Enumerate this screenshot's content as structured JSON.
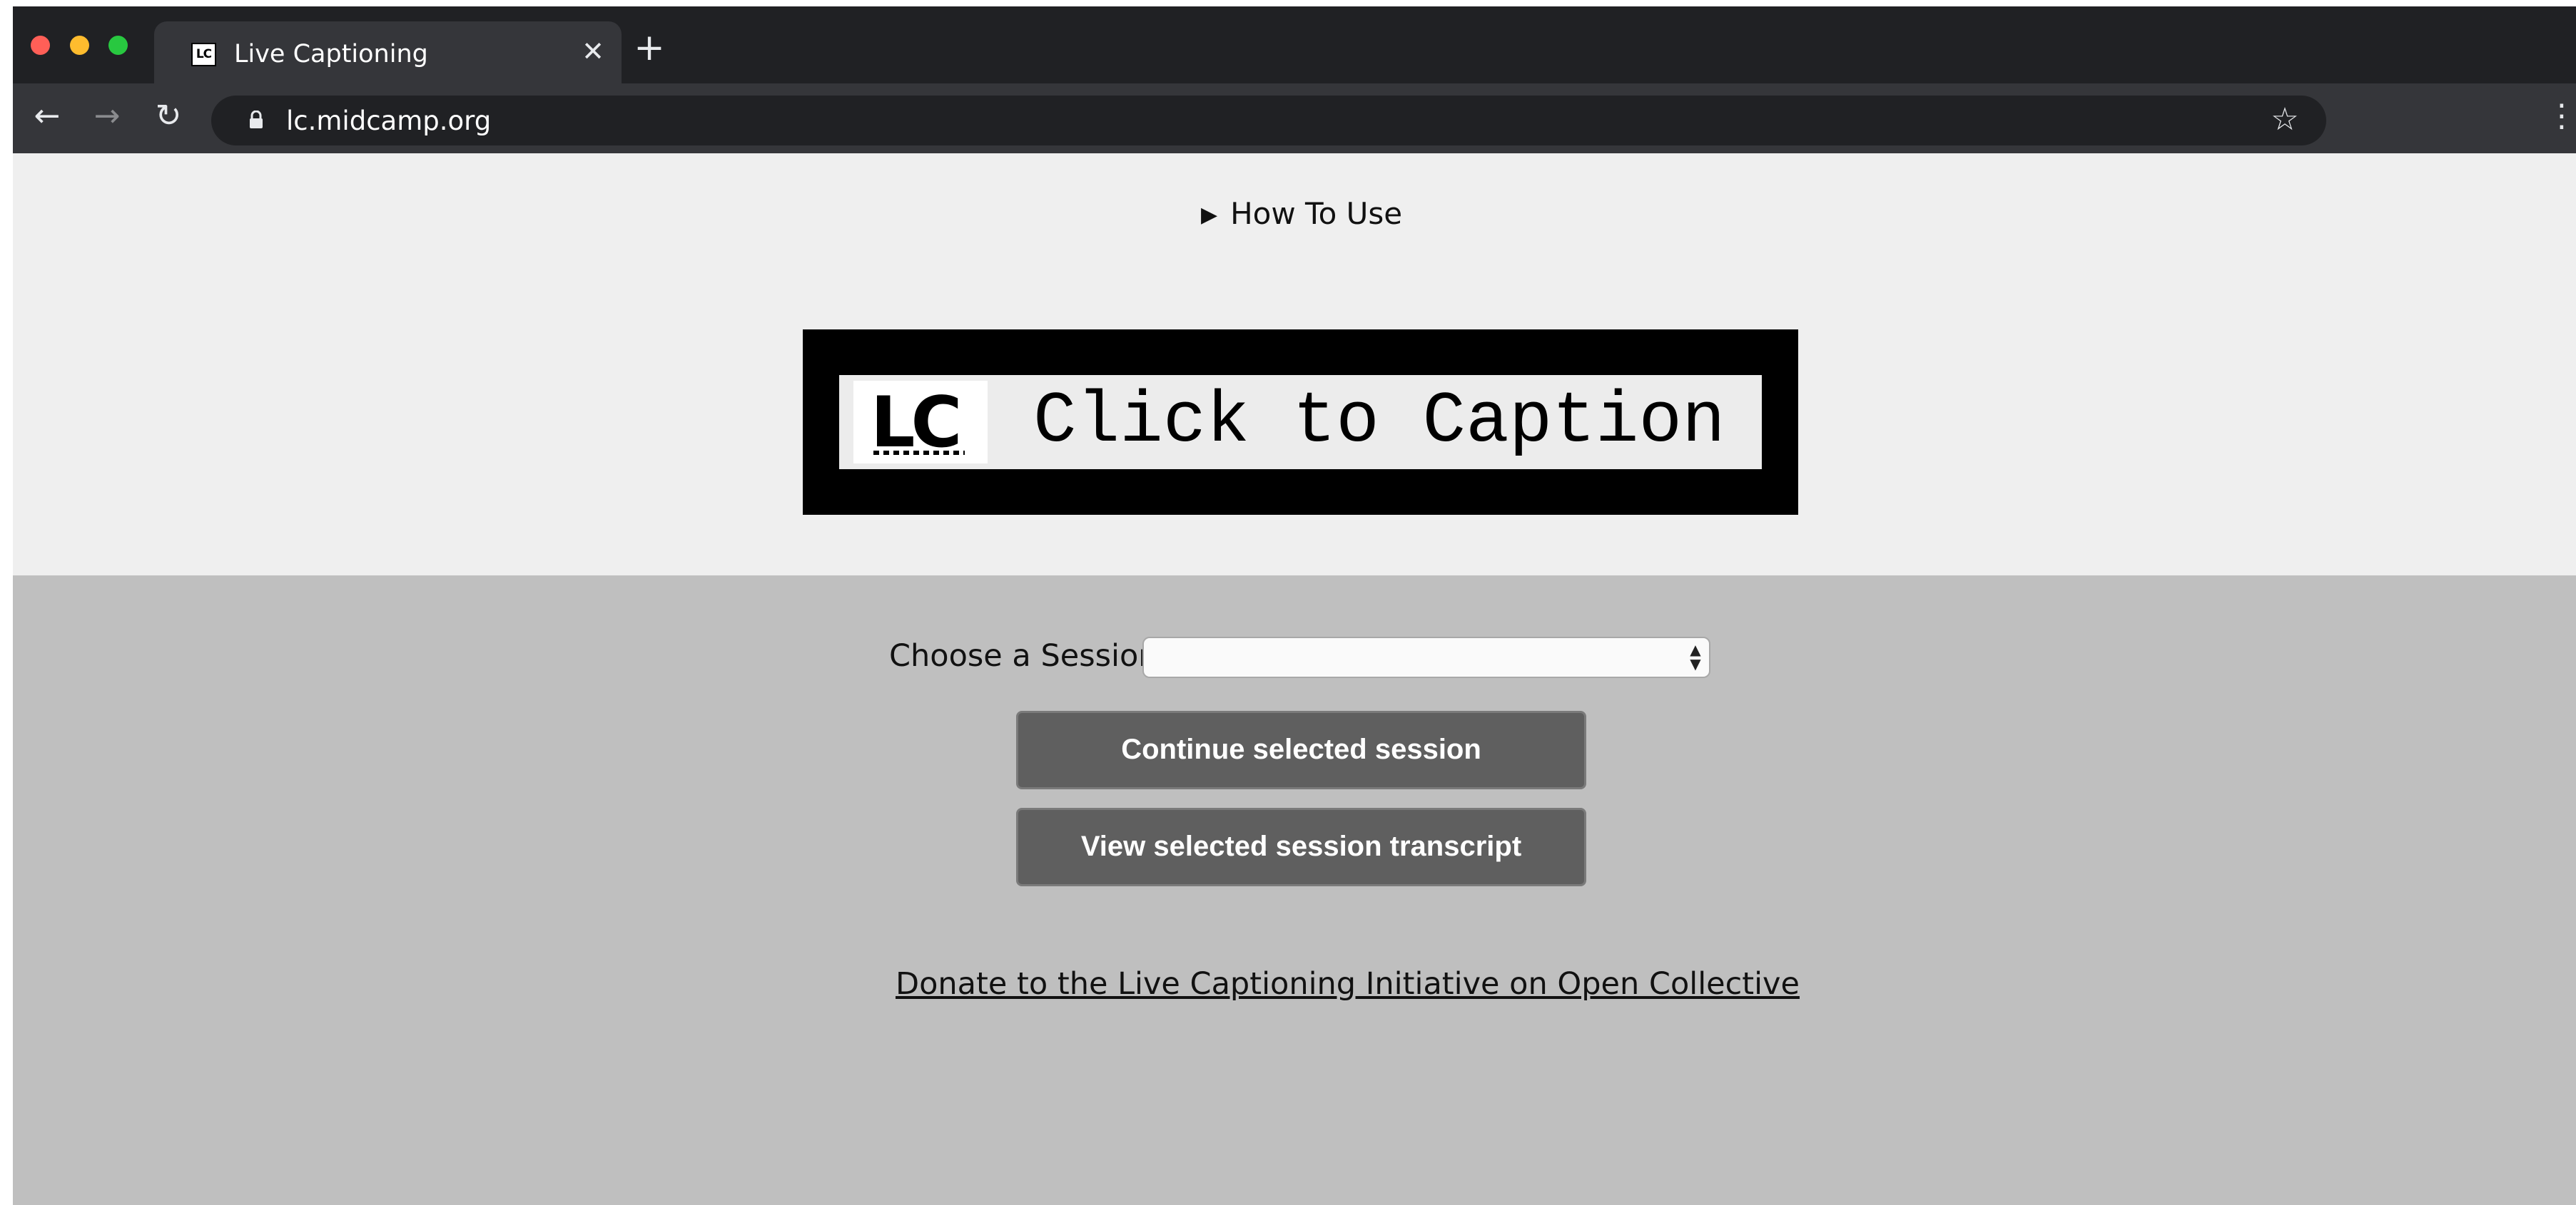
{
  "browser": {
    "tab": {
      "title": "Live Captioning",
      "favicon_text": "LC",
      "close_glyph": "✕"
    },
    "new_tab_glyph": "+",
    "nav": {
      "back_glyph": "←",
      "forward_glyph": "→",
      "reload_glyph": "↻"
    },
    "address_bar": {
      "url": "lc.midcamp.org"
    },
    "icons": {
      "star": "☆",
      "menu": "⋮"
    }
  },
  "page": {
    "how_to": {
      "marker": "▶",
      "label": "How To Use"
    },
    "banner": {
      "logo_text": "LC",
      "text": "Click to Caption"
    },
    "session": {
      "label": "Choose a Session",
      "selected_value": "",
      "arrows": "▲▼"
    },
    "buttons": {
      "continue": "Continue selected session",
      "view_transcript": "View selected session transcript"
    },
    "donate_link": "Donate to the Live Captioning Initiative on Open Collective"
  },
  "colors": {
    "top_section_bg": "#efefef",
    "bottom_section_bg": "#bfbfbf",
    "button_bg": "#5f5f5f",
    "banner_bg": "#000000"
  }
}
